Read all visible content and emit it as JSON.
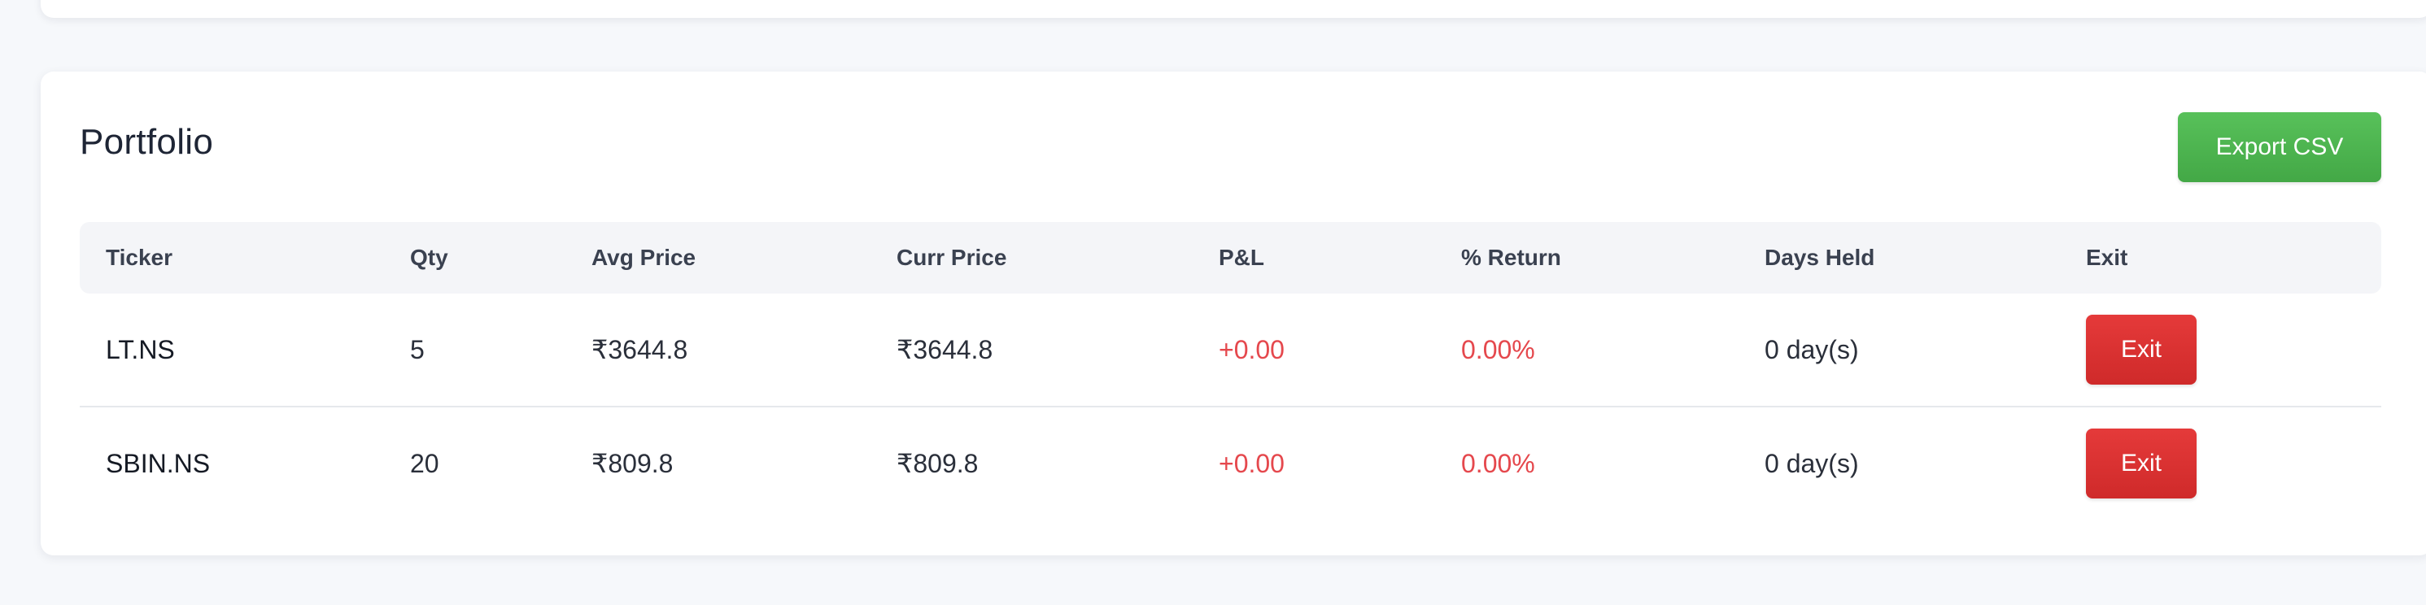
{
  "portfolio": {
    "title": "Portfolio",
    "export_label": "Export CSV",
    "columns": [
      "Ticker",
      "Qty",
      "Avg Price",
      "Curr Price",
      "P&L",
      "% Return",
      "Days Held",
      "Exit"
    ],
    "rows": [
      {
        "ticker": "LT.NS",
        "qty": "5",
        "avg_price": "₹3644.8",
        "curr_price": "₹3644.8",
        "pnl": "+0.00",
        "return": "0.00%",
        "days_held": "0 day(s)",
        "exit_label": "Exit"
      },
      {
        "ticker": "SBIN.NS",
        "qty": "20",
        "avg_price": "₹809.8",
        "curr_price": "₹809.8",
        "pnl": "+0.00",
        "return": "0.00%",
        "days_held": "0 day(s)",
        "exit_label": "Exit"
      }
    ]
  },
  "colors": {
    "export_button": "#4caf50",
    "exit_button": "#dc3333",
    "pnl_text": "#e5484d",
    "background": "#f6f8fb"
  },
  "icons": {
    "floating_button": "settings-toggle-icon"
  }
}
